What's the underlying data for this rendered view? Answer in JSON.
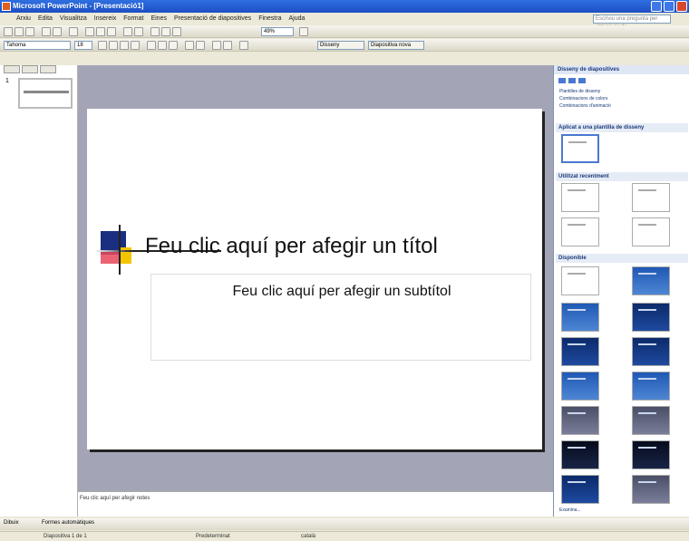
{
  "window": {
    "title": "Microsoft PowerPoint - [Presentació1]"
  },
  "menu": {
    "items": [
      "Arxiu",
      "Edita",
      "Visualitza",
      "Insereix",
      "Format",
      "Eines",
      "Presentació de diapositives",
      "Finestra",
      "Ajuda"
    ],
    "help_box": "Escriviu una pregunta per obtenir ajuda"
  },
  "toolbar": {
    "font_name": "Tahoma",
    "font_size": "18",
    "zoom": "49%",
    "design_button": "Disseny",
    "new_slide_button": "Diapositiva nova"
  },
  "thumbnails": {
    "slide_number": "1"
  },
  "slide": {
    "title_placeholder": "Feu clic aquí per afegir un títol",
    "subtitle_placeholder": "Feu clic aquí per afegir un subtítol"
  },
  "notes": {
    "placeholder": "Feu clic aquí per afegir notes"
  },
  "task_pane": {
    "title": "Disseny de diapositives",
    "links": [
      "Plantilles de disseny",
      "Combinacions de colors",
      "Combinacions d'animació"
    ],
    "section_applied": "Aplicat a una plantilla de disseny",
    "section_recent": "Utilitzat recentment",
    "section_available": "Disponible",
    "footer_link": "Examina..."
  },
  "drawing": {
    "label": "Dibuix",
    "autoshapes": "Formes automàtiques"
  },
  "status": {
    "slide": "Diapositiva 1 de 1",
    "design": "Predeterminat",
    "language": "català"
  }
}
